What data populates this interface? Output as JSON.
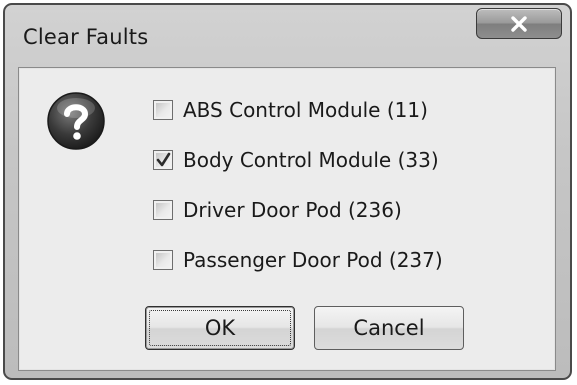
{
  "window": {
    "title": "Clear Faults",
    "close_label": "x"
  },
  "icons": {
    "dialog_icon": "question-icon",
    "close_icon": "close-icon",
    "check_icon": "checkmark-icon"
  },
  "modules": [
    {
      "label": "ABS Control Module (11)",
      "checked": false
    },
    {
      "label": "Body Control Module (33)",
      "checked": true
    },
    {
      "label": "Driver Door Pod (236)",
      "checked": false
    },
    {
      "label": "Passenger Door Pod (237)",
      "checked": false
    }
  ],
  "buttons": {
    "ok_label": "OK",
    "cancel_label": "Cancel",
    "default_button": "OK"
  }
}
